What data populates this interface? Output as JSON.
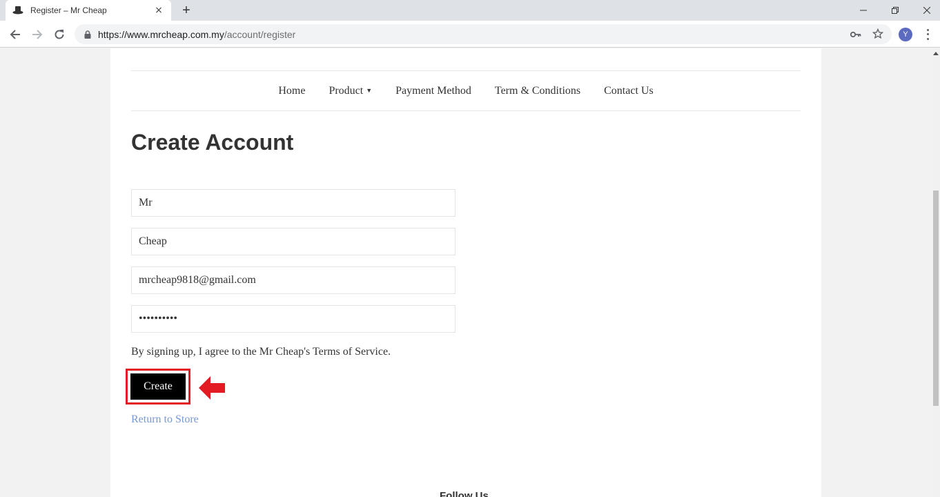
{
  "browser": {
    "tab_title": "Register – Mr Cheap",
    "tab_close": "×",
    "new_tab": "+",
    "url_host": "https://www.mrcheap.com.my",
    "url_path": "/account/register",
    "profile_initial": "Y"
  },
  "nav": {
    "items": [
      "Home",
      "Product",
      "Payment Method",
      "Term & Conditions",
      "Contact Us"
    ],
    "product_caret": "▼"
  },
  "form": {
    "title": "Create Account",
    "first_name": "Mr",
    "last_name": "Cheap",
    "email": "mrcheap9818@gmail.com",
    "password": "••••••••••",
    "agree_text": "By signing up, I agree to the Mr Cheap's Terms of Service.",
    "create_label": "Create",
    "return_label": "Return to Store"
  },
  "footer": {
    "follow_label": "Follow Us"
  },
  "colors": {
    "highlight": "#e31b23",
    "link": "#7898d4",
    "button_bg": "#000000"
  }
}
